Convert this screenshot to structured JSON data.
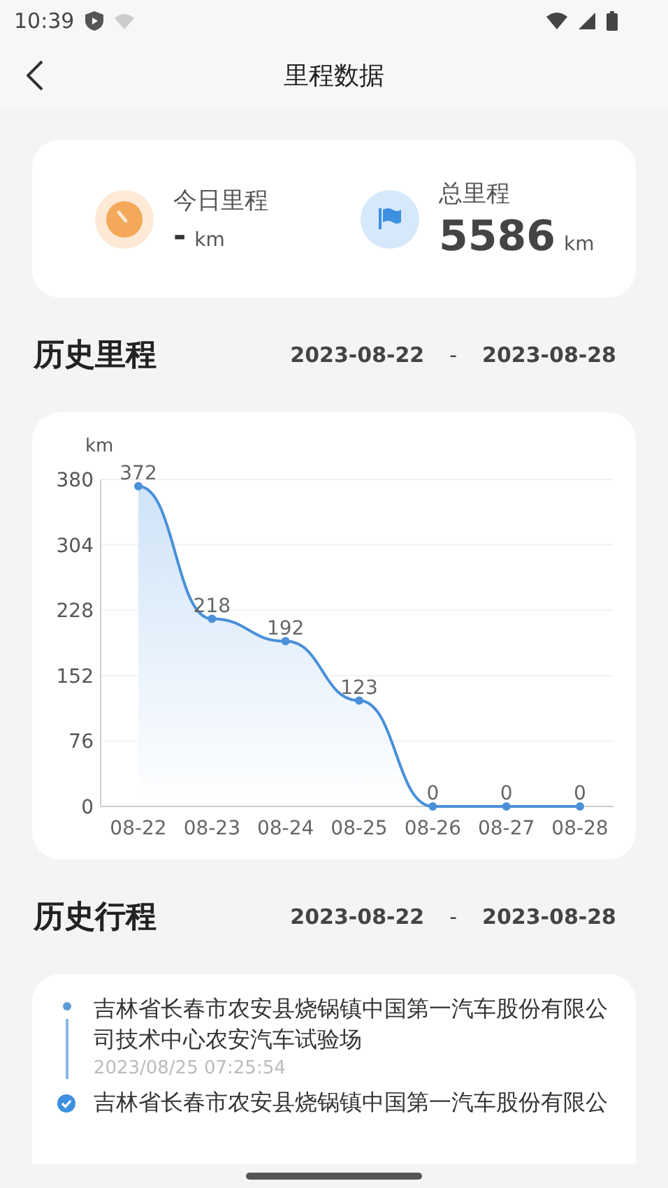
{
  "status_bar": {
    "time": "10:39"
  },
  "header": {
    "title": "里程数据"
  },
  "summary": [
    {
      "kind": "today",
      "label": "今日里程",
      "value": "-",
      "unit": "km"
    },
    {
      "kind": "total",
      "label": "总里程",
      "value": "5586",
      "unit": "km"
    }
  ],
  "mileage_history": {
    "title": "历史里程",
    "date_from": "2023-08-22",
    "separator": "-",
    "date_to": "2023-08-28",
    "chart_data": {
      "type": "area",
      "ylabel": "km",
      "categories": [
        "08-22",
        "08-23",
        "08-24",
        "08-25",
        "08-26",
        "08-27",
        "08-28"
      ],
      "series": [
        {
          "color": "#4a90d9",
          "values": [
            372,
            218,
            192,
            123,
            0,
            0,
            0
          ]
        }
      ],
      "grid": true,
      "ylim": [
        0,
        380
      ],
      "yticks": [
        0,
        76,
        152,
        228,
        304,
        380
      ],
      "data_labels": true
    }
  },
  "trip_history": {
    "title": "历史行程",
    "date_from": "2023-08-22",
    "separator": "-",
    "date_to": "2023-08-28",
    "trips": [
      {
        "kind": "dot",
        "address": "吉林省长春市农安县烧锅镇中国第一汽车股份有限公司技术中心农安汽车试验场",
        "time": "2023/08/25 07:25:54"
      },
      {
        "kind": "check",
        "address": "吉林省长春市农安县烧锅镇中国第一汽车股份有限公"
      }
    ]
  }
}
